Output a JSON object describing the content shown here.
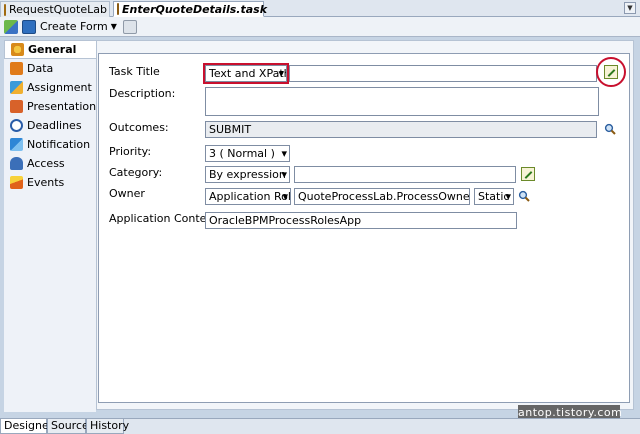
{
  "doc_tabs": [
    {
      "label": "RequestQuoteLab",
      "icon": "xml-file-icon"
    },
    {
      "label": "EnterQuoteDetails.task",
      "icon": "task-file-icon"
    }
  ],
  "toolbar": {
    "create_form_label": "Create Form"
  },
  "nav": {
    "items": [
      {
        "label": "General",
        "active": true
      },
      {
        "label": "Data"
      },
      {
        "label": "Assignment"
      },
      {
        "label": "Presentation"
      },
      {
        "label": "Deadlines"
      },
      {
        "label": "Notification"
      },
      {
        "label": "Access"
      },
      {
        "label": "Events"
      }
    ]
  },
  "form": {
    "task_title_label": "Task Title",
    "task_title_mode": "Text and XPath",
    "task_title_value": "",
    "description_label": "Description:",
    "description_value": "",
    "outcomes_label": "Outcomes:",
    "outcomes_value": "SUBMIT",
    "priority_label": "Priority:",
    "priority_value": "3 ( Normal )",
    "category_label": "Category:",
    "category_mode": "By expression",
    "category_value": "",
    "owner_label": "Owner",
    "owner_type": "Application Role",
    "owner_value": "QuoteProcessLab.ProcessOwner",
    "owner_binding": "Static",
    "app_context_label": "Application Context:",
    "app_context_value": "OracleBPMProcessRolesApp"
  },
  "bottom_tabs": [
    {
      "label": "Designer",
      "active": true
    },
    {
      "label": "Source"
    },
    {
      "label": "History"
    }
  ],
  "watermark": "antop.tistory.com",
  "colors": {
    "highlight": "#c8102e",
    "panel_bg": "#ffffff",
    "chrome_bg": "#c6d4e4"
  }
}
